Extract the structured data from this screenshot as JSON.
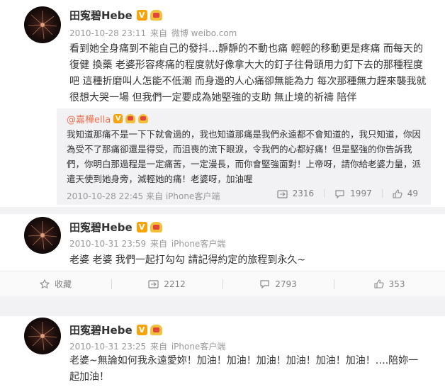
{
  "posts": [
    {
      "name": "田寃碧Hebe",
      "badge_v": "V",
      "date": "2010-10-28 23:11",
      "source_prefix": "来自",
      "source": "微博 weibo.com",
      "text": "看到她全身痛到不能自己的發抖…靜靜的不動也痛 輕輕的移動更是疼痛  而每天的復健 換藥 老婆形容疼痛的程度就好像拿大大的釘子往骨頭用力釘下去的那種程度吧 這種折磨叫人怎能不低潮 而身邊的人心痛卻無能為力 每次那種無力趕來襲我就很想大哭一場 但我們一定要成為她堅強的支助 無止境的祈禱 陪伴",
      "repost": {
        "user": "@嘉樺ella",
        "badge_v": "V",
        "text": "我知道那痛不是一下下就會過的，我也知道那痛是我們永遠都不會知道的，我只知道，你因為受不了那痛卻還是得受，而沮喪的流下眼淚，令我們的心都好痛！但是堅強的你告訴我們，你明白那過程是一定痛苦，一定漫長，而你會堅強面對！上帝呀，請你給老婆力量，派遣天使到她身旁，減輕她的痛！老婆呀，加油喔",
        "date": "2010-10-28 22:45",
        "source_prefix": "来自",
        "source": "iPhone客户端",
        "reposts": "2316",
        "comments": "1997",
        "likes": "49"
      }
    },
    {
      "name": "田寃碧Hebe",
      "badge_v": "V",
      "date": "2010-10-31 23:59",
      "source_prefix": "来自",
      "source": "iPhone客户端",
      "text": "老婆 老婆 我們一起打勾勾 請記得約定的旅程到永久~",
      "toolbar": {
        "favorite": "收藏",
        "reposts": "2212",
        "comments": "2793",
        "likes": "353"
      }
    },
    {
      "name": "田寃碧Hebe",
      "badge_v": "V",
      "date": "2010-10-31 23:25",
      "source_prefix": "来自",
      "source": "iPhone客户端",
      "text": "老婆~無論如何我永遠愛妳！加油！加油！加油！加油！加油！加油！….陪妳一起加油！"
    }
  ]
}
